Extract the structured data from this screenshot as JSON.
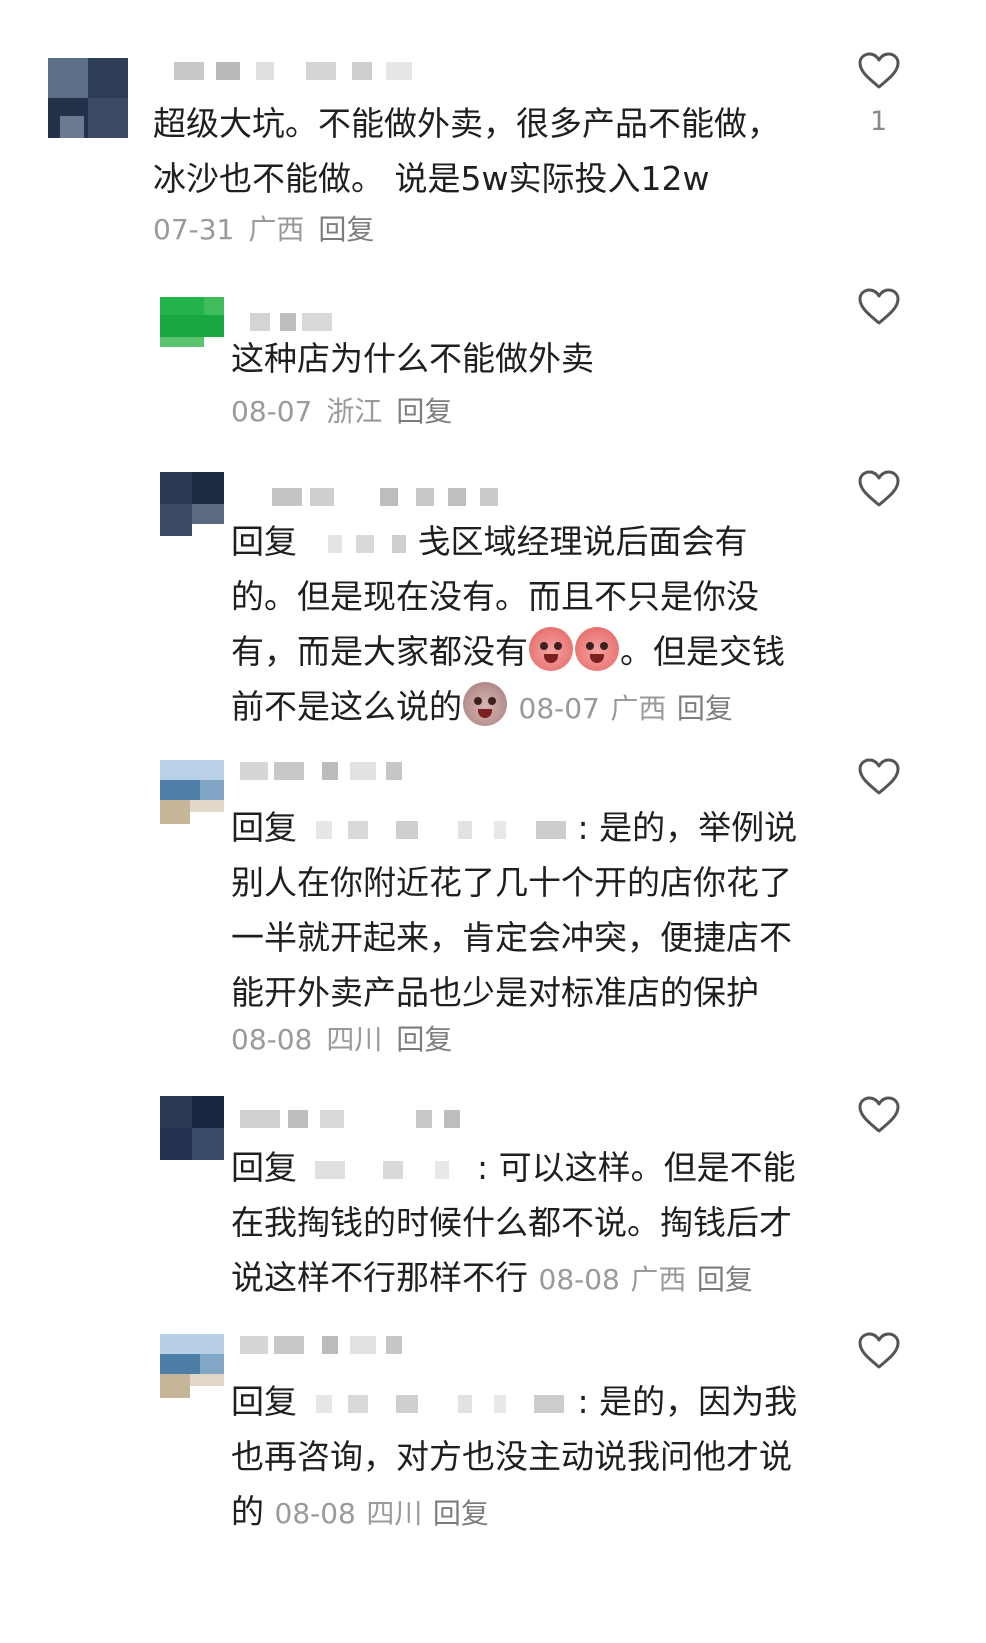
{
  "comments": [
    {
      "text": "超级大坑。不能做外卖，很多产品不能做，冰沙也不能做。 说是5w实际投入12w",
      "date": "07-31",
      "location": "广西",
      "reply": "回复",
      "likes": "1"
    },
    {
      "text": "这种店为什么不能做外卖",
      "date": "08-07",
      "location": "浙江",
      "reply": "回复"
    },
    {
      "prefix": "回复",
      "text_a": "戋区域经理说后面会有的。但是现在没有。而且不只是你没有，而是大家都没有",
      "text_b": "。但是交钱前不是这么说的",
      "date": "08-07",
      "location": "广西",
      "reply": "回复"
    },
    {
      "prefix": "回复",
      "text": ": 是的，举例说别人在你附近花了几十个开的店你花了一半就开起来，肯定会冲突，便捷店不能开外卖产品也少是对标准店的保护",
      "date": "08-08",
      "location": "四川",
      "reply": "回复"
    },
    {
      "prefix": "回复",
      "text": ": 可以这样。但是不能在我掏钱的时候什么都不说。掏钱后才说这样不行那样不行",
      "date": "08-08",
      "location": "广西",
      "reply": "回复"
    },
    {
      "prefix": "回复",
      "text": ": 是的，因为我也再咨询，对方也没主动说我问他才说的",
      "date": "08-08",
      "location": "四川",
      "reply": "回复"
    }
  ],
  "colors": {
    "text": "#1f1f1f",
    "meta": "#9a9a9a",
    "icon": "#555555"
  },
  "icons": [
    "heart-outline-icon",
    "emoji-angry-icon",
    "emoji-crying-icon"
  ]
}
